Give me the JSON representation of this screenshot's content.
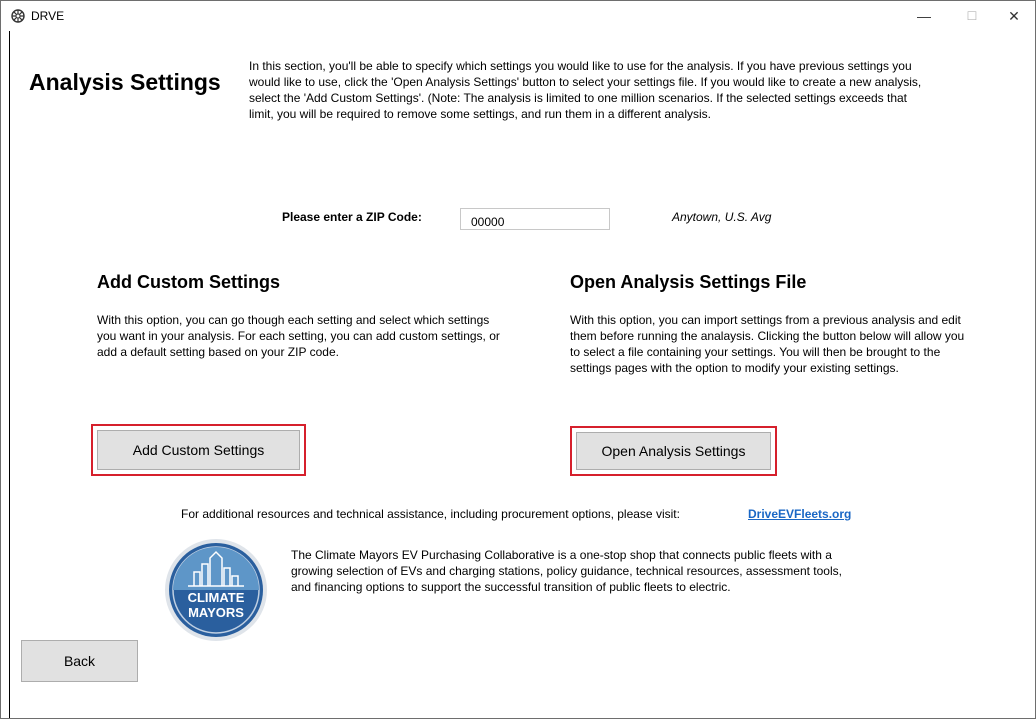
{
  "window": {
    "title": "DRVE",
    "icon": "drve-app-icon",
    "controls": {
      "minimize": "—",
      "maximize": "☐",
      "close": "✕"
    }
  },
  "header": {
    "title": "Analysis Settings",
    "intro": "In this section, you'll be able to specify which settings you would like to use for the analysis. If you have previous settings you would like to use, click the 'Open Analysis Settings' button to select your settings file. If you would like to create a new analysis, select the 'Add Custom Settings'. (Note: The analysis is limited to one million scenarios. If the selected settings exceeds that limit, you will be required to remove some settings, and run them in a different analysis."
  },
  "zip": {
    "label": "Please enter a ZIP Code:",
    "value": "00000",
    "location": "Anytown, U.S. Avg"
  },
  "custom_section": {
    "title": "Add Custom Settings",
    "description": "With this option, you can go though each setting and select which settings you want in your analysis. For each setting, you can add custom settings, or add a default setting based on your ZIP code.",
    "button_label": "Add Custom Settings"
  },
  "open_section": {
    "title": "Open Analysis Settings File",
    "description": "With this option, you can import settings from a previous analysis and edit them before running the analaysis. Clicking the button below will allow you to select a file containing your settings. You will then be brought to the settings pages with the option to modify your existing settings.",
    "button_label": "Open Analysis Settings"
  },
  "resources": {
    "text": "For additional resources and technical assistance, including procurement options, please visit:",
    "link": "DriveEVFleets.org"
  },
  "climate": {
    "logo_line1": "CLIMATE",
    "logo_line2": "MAYORS",
    "description": "The Climate Mayors EV Purchasing Collaborative is a one-stop shop that connects public fleets with a growing selection of EVs and charging stations, policy guidance, technical resources, assessment tools, and financing options to support the successful transition of public fleets to electric."
  },
  "footer": {
    "back_label": "Back"
  },
  "colors": {
    "highlight_border": "#d6202c",
    "link": "#1a67c5",
    "button_bg": "#e1e1e1",
    "logo_blue": "#2a5f9e"
  }
}
